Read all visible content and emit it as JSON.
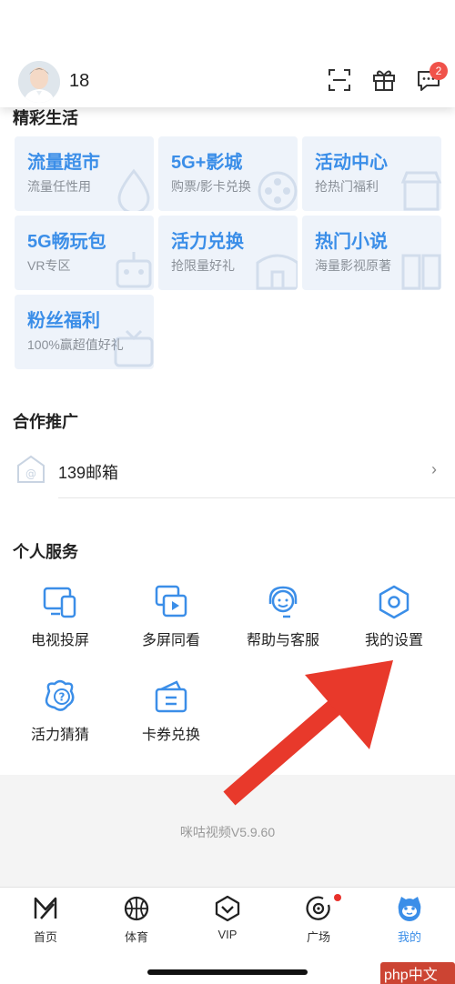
{
  "header": {
    "username": "18",
    "icons": [
      "scan-icon",
      "gift-icon",
      "message-icon"
    ],
    "message_badge": "2"
  },
  "sections": {
    "lifestyle_title": "精彩生活",
    "partner_title": "合作推广",
    "service_title": "个人服务"
  },
  "tiles": [
    {
      "title": "流量超市",
      "sub": "流量任性用"
    },
    {
      "title": "5G+影城",
      "sub": "购票/影卡兑换"
    },
    {
      "title": "活动中心",
      "sub": "抢热门福利"
    },
    {
      "title": "5G畅玩包",
      "sub": "VR专区"
    },
    {
      "title": "活力兑换",
      "sub": "抢限量好礼"
    },
    {
      "title": "热门小说",
      "sub": "海量影视原著"
    },
    {
      "title": "粉丝福利",
      "sub": "100%赢超值好礼"
    }
  ],
  "partner": {
    "label": "139邮箱",
    "arrow": "›"
  },
  "services": [
    {
      "label": "电视投屏",
      "icon": "tv-cast-icon"
    },
    {
      "label": "多屏同看",
      "icon": "multi-screen-icon"
    },
    {
      "label": "帮助与客服",
      "icon": "customer-service-icon"
    },
    {
      "label": "我的设置",
      "icon": "settings-icon"
    },
    {
      "label": "活力猜猜",
      "icon": "guess-icon"
    },
    {
      "label": "卡券兑换",
      "icon": "coupon-icon"
    }
  ],
  "version": "咪咕视频V5.9.60",
  "tabbar": {
    "tabs": [
      {
        "label": "首页",
        "icon": "home-icon"
      },
      {
        "label": "体育",
        "icon": "basketball-icon"
      },
      {
        "label": "VIP",
        "icon": "vip-icon"
      },
      {
        "label": "广场",
        "icon": "plaza-icon"
      },
      {
        "label": "我的",
        "icon": "mine-icon"
      }
    ],
    "active": "我的"
  },
  "colors": {
    "accent": "#3b8ee8",
    "badge": "#f0524a",
    "arrow": "#e8392b",
    "tile_bg": "#eef3fa"
  },
  "watermark": "php中文网"
}
